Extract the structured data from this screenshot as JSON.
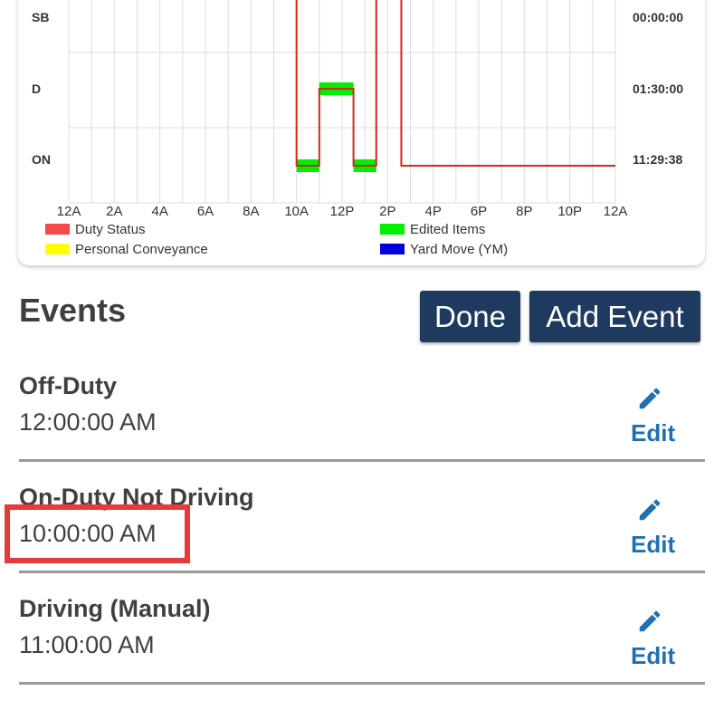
{
  "chart": {
    "row_labels": [
      "SB",
      "D",
      "ON"
    ],
    "totals": [
      "00:00:00",
      "01:30:00",
      "11:29:38"
    ],
    "x_ticks": [
      "12A",
      "2A",
      "4A",
      "6A",
      "8A",
      "10A",
      "12P",
      "2P",
      "4P",
      "6P",
      "8P",
      "10P",
      "12A"
    ],
    "legend": [
      {
        "label": "Duty Status",
        "color": "#f44a4a"
      },
      {
        "label": "Edited Items",
        "color": "#00ee00"
      },
      {
        "label": "Personal Conveyance",
        "color": "#ffff00"
      },
      {
        "label": "Yard Move (YM)",
        "color": "#0000dd"
      }
    ]
  },
  "chart_data": {
    "type": "line",
    "x_unit": "hour of day",
    "x_ticks": [
      "12A",
      "2A",
      "4A",
      "6A",
      "8A",
      "10A",
      "12P",
      "2P",
      "4P",
      "6P",
      "8P",
      "10P",
      "12A"
    ],
    "y_categories": [
      "SB",
      "D",
      "ON"
    ],
    "duty_status_steps": [
      {
        "x": 10.0,
        "status": "ON"
      },
      {
        "x": 11.0,
        "status": "D"
      },
      {
        "x": 12.5,
        "status": "ON"
      },
      {
        "x": 13.5,
        "status": "above-SB"
      },
      {
        "x": 14.6,
        "status": "ON"
      },
      {
        "x": 24.0,
        "status": "ON"
      }
    ],
    "edited_items": [
      {
        "start": 10.0,
        "end": 11.0,
        "status": "ON"
      },
      {
        "start": 11.0,
        "end": 12.5,
        "status": "D"
      },
      {
        "start": 12.5,
        "end": 13.5,
        "status": "ON"
      }
    ]
  },
  "actions": {
    "title": "Events",
    "done": "Done",
    "add": "Add Event"
  },
  "events": [
    {
      "type": "Off-Duty",
      "time": "12:00:00 AM",
      "edit": "Edit"
    },
    {
      "type": "On-Duty Not Driving",
      "time": "10:00:00 AM",
      "edit": "Edit"
    },
    {
      "type": "Driving (Manual)",
      "time": "11:00:00 AM",
      "edit": "Edit"
    }
  ]
}
